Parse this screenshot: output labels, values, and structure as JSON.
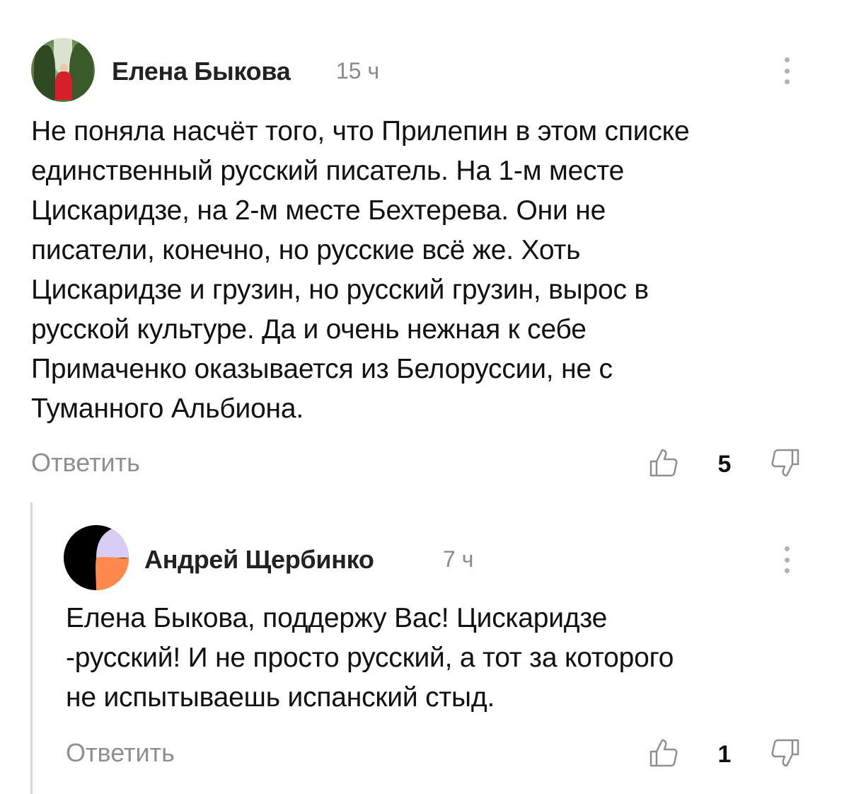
{
  "comment": {
    "author": "Елена Быкова",
    "time": "15 ч",
    "text_lines": [
      "Не поняла насчёт того, что Прилепин в этом списке",
      "единственный русский писатель. На 1-м месте",
      "Цискаридзе, на 2-м месте Бехтерева. Они не",
      "писатели, конечно, но русские всё же. Хоть",
      "Цискаридзе и грузин, но русский грузин, вырос в",
      "русской культуре. Да и очень нежная к себе",
      "Примаченко оказывается из Белоруссии, не с",
      "Туманного Альбиона."
    ],
    "reply_label": "Ответить",
    "likes": "5",
    "avatar_icon": "user-photo-avatar",
    "more_icon": "more-vertical-icon"
  },
  "reply": {
    "author": "Андрей Щербинко",
    "time": "7 ч",
    "text_lines": [
      "Елена Быкова, поддержу Вас! Цискаридзе",
      "-русский! И не просто русский, а тот за которого",
      "не испытываешь испанский стыд."
    ],
    "reply_label": "Ответить",
    "likes": "1",
    "avatar_icon": "logo-avatar",
    "more_icon": "more-vertical-icon"
  },
  "colors": {
    "text": "#111111",
    "secondary": "#8f8f8f",
    "thread_line": "#d4d4d4",
    "logo_black": "#000000",
    "logo_lavender": "#d9ccf5",
    "logo_orange": "#ff8a4c"
  }
}
